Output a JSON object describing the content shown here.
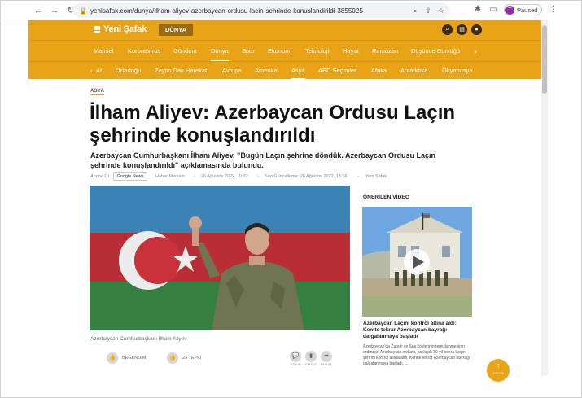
{
  "browser": {
    "url": "yenisafak.com/dunya/ilham-aliyev-azerbaycan-ordusu-lacin-sehrinde-konuslandirildi-3855025",
    "profile_initial": "T",
    "profile_label": "Paused"
  },
  "site": {
    "logo": "Yeni Şafak",
    "section_badge": "DÜNYA",
    "accent_color": "#e8a317"
  },
  "main_nav": {
    "items": [
      "Manşet",
      "Koronavirüs",
      "Gündem",
      "Dünya",
      "Spor",
      "Ekonomi",
      "Teknoloji",
      "Hayat",
      "Ramazan",
      "Düşünce Günlüğü"
    ],
    "active_index": 3
  },
  "sub_nav": {
    "back_label": "Af",
    "items": [
      "Ortadoğu",
      "Zeytin Dalı Harekatı",
      "Avrupa",
      "Amerika",
      "Asya",
      "ABD Seçimleri",
      "Afrika",
      "Antarktika",
      "Okyanusya"
    ],
    "active_index": 4
  },
  "article": {
    "category": "ASYA",
    "headline": "İlham Aliyev: Azerbaycan Ordusu Laçın şehrinde konuşlandırıldı",
    "lead": "Azerbaycan Cumhurbaşkanı İlham Aliyev, \"Bugün Laçın şehrine döndük. Azerbaycan Ordusu Laçın şehrinde konuşlandırıldı\" açıklamasında bulundu.",
    "follow_label": "Abone Ol",
    "gnews_label": "Google News",
    "source": "Haber Merkezi",
    "published": "26 Ağustos 2022, 10:32",
    "updated": "Son Güncelleme: 26 Ağustos 2022, 13:36",
    "author": "Yeni Şafak",
    "caption": "Azerbaycan Cumhurbaşkanı İlham Aliyev"
  },
  "actions": {
    "like_label": "BEĞENDİM",
    "dislike_label": "23 TEPKİ",
    "comment_label": "YORUM",
    "save_label": "KAYDET",
    "share_label": "PAYLAŞ"
  },
  "sidebar": {
    "title": "ÖNERİLEN VİDEO",
    "video_title": "Azerbaycan Laçını kontrol altına aldı: Kentte tekrar Azerbaycan bayrağı dalgalanmaya başladı",
    "video_desc": "Azerbaycan'da Zabuh ve Sus köylerinin temizlenmesinin ardından Azerbaycan ordusu, yaklaşık 30 yıl sonra Laçın şehrini kontrol altına aldı. Kentte tekrar Azerbaycan bayrağı dalgalanmaya başladı, ..."
  },
  "scroll_top_label": "YUKARI"
}
